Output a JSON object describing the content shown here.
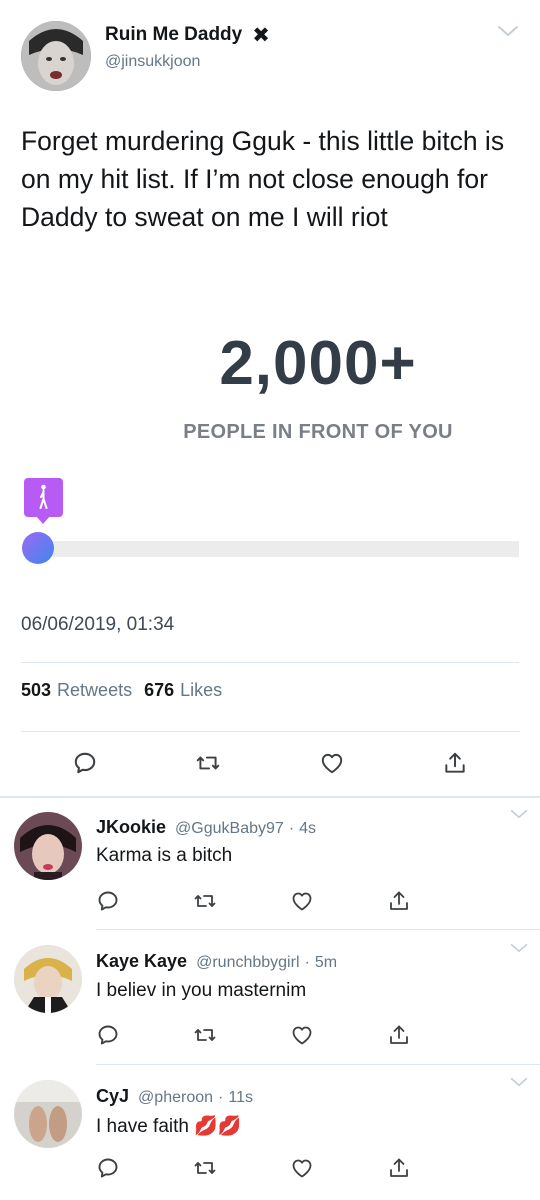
{
  "tweet": {
    "display_name": "Ruin Me Daddy",
    "handle": "@jinsukkjoon",
    "text": "Forget murdering Gguk - this little bitch is on my hit list. If I’m not close enough for Daddy to sweat on me I will riot",
    "embed": {
      "count": "2,000+",
      "caption": "PEOPLE IN FRONT OF YOU",
      "progress_fraction": 0.0,
      "marker_color": "#b65cf5",
      "track_color": "#ececec"
    },
    "timestamp": "06/06/2019, 01:34",
    "stats": {
      "retweets_count": "503",
      "retweets_label": "Retweets",
      "likes_count": "676",
      "likes_label": "Likes"
    }
  },
  "replies": [
    {
      "name": "JKookie",
      "handle": "@GgukBaby97",
      "sep": "·",
      "time": "4s",
      "text": "Karma is a bitch"
    },
    {
      "name": "Kaye Kaye",
      "handle": "@runchbbygirl",
      "sep": "·",
      "time": "5m",
      "text": "I believ in you masternim"
    },
    {
      "name": "CyJ",
      "handle": "@pheroon",
      "sep": "·",
      "time": "11s",
      "text": "I have faith 💋💋"
    }
  ],
  "icons": {
    "reply": "comment-bubble-icon",
    "retweet": "retweet-icon",
    "like": "heart-icon",
    "share": "share-icon",
    "more": "chevron-down-icon"
  },
  "colors": {
    "text": "#14171a",
    "secondary": "#657786",
    "divider": "#e1e8ed"
  }
}
